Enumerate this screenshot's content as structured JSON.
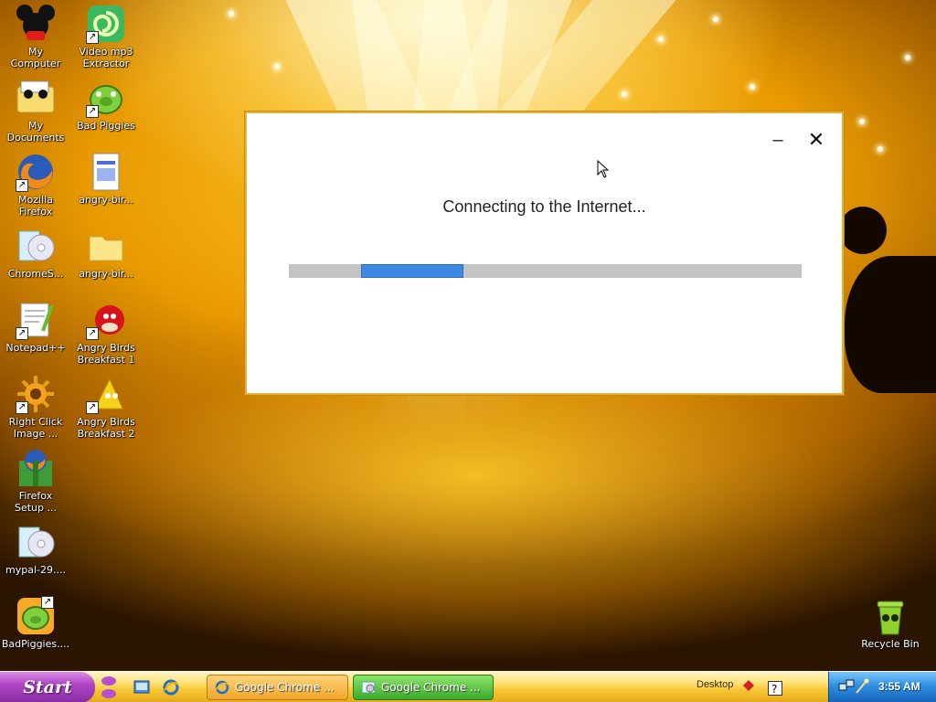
{
  "desktop": {
    "icons": [
      {
        "label": "My\nComputer",
        "icon": "mickey-computer-icon"
      },
      {
        "label": "Video mp3\nExtractor",
        "icon": "video-mp3-extractor-icon"
      },
      {
        "label": "My\nDocuments",
        "icon": "my-documents-folder-icon"
      },
      {
        "label": "Bad Piggies",
        "icon": "bad-piggies-icon"
      },
      {
        "label": "Mozilla\nFirefox",
        "icon": "firefox-icon"
      },
      {
        "label": "angry-bir...",
        "icon": "document-file-icon"
      },
      {
        "label": "ChromeS...",
        "icon": "installer-cd-icon"
      },
      {
        "label": "angry-bir...",
        "icon": "folder-icon"
      },
      {
        "label": "Notepad++",
        "icon": "notepad-plus-plus-icon"
      },
      {
        "label": "Angry Birds\nBreakfast 1",
        "icon": "angry-birds-red-icon"
      },
      {
        "label": "Right Click\nImage ...",
        "icon": "right-click-image-icon"
      },
      {
        "label": "Angry Birds\nBreakfast 2",
        "icon": "angry-birds-yellow-icon"
      },
      {
        "label": "Firefox\nSetup ...",
        "icon": "firefox-setup-icon"
      },
      {
        "label": "mypal-29....",
        "icon": "installer-cd-icon"
      },
      {
        "label": "BadPiggies....",
        "icon": "bad-piggies-icon"
      },
      {
        "label": "Recycle Bin",
        "icon": "recycle-bin-icon"
      }
    ]
  },
  "dialog": {
    "message": "Connecting to the Internet...",
    "minimize_glyph": "–",
    "close_glyph": "✕",
    "progress": {
      "fill_start": 0.14,
      "fill_fraction": 0.2,
      "color": "#3c88e4"
    }
  },
  "taskbar": {
    "start_label": "Start",
    "buttons": [
      {
        "label": "Google Chrome ...",
        "icon": "ie-icon"
      },
      {
        "label": "Google Chrome ...",
        "icon": "chrome-setup-icon"
      }
    ],
    "desktop_label": "Desktop",
    "clock": "3:55 AM"
  }
}
